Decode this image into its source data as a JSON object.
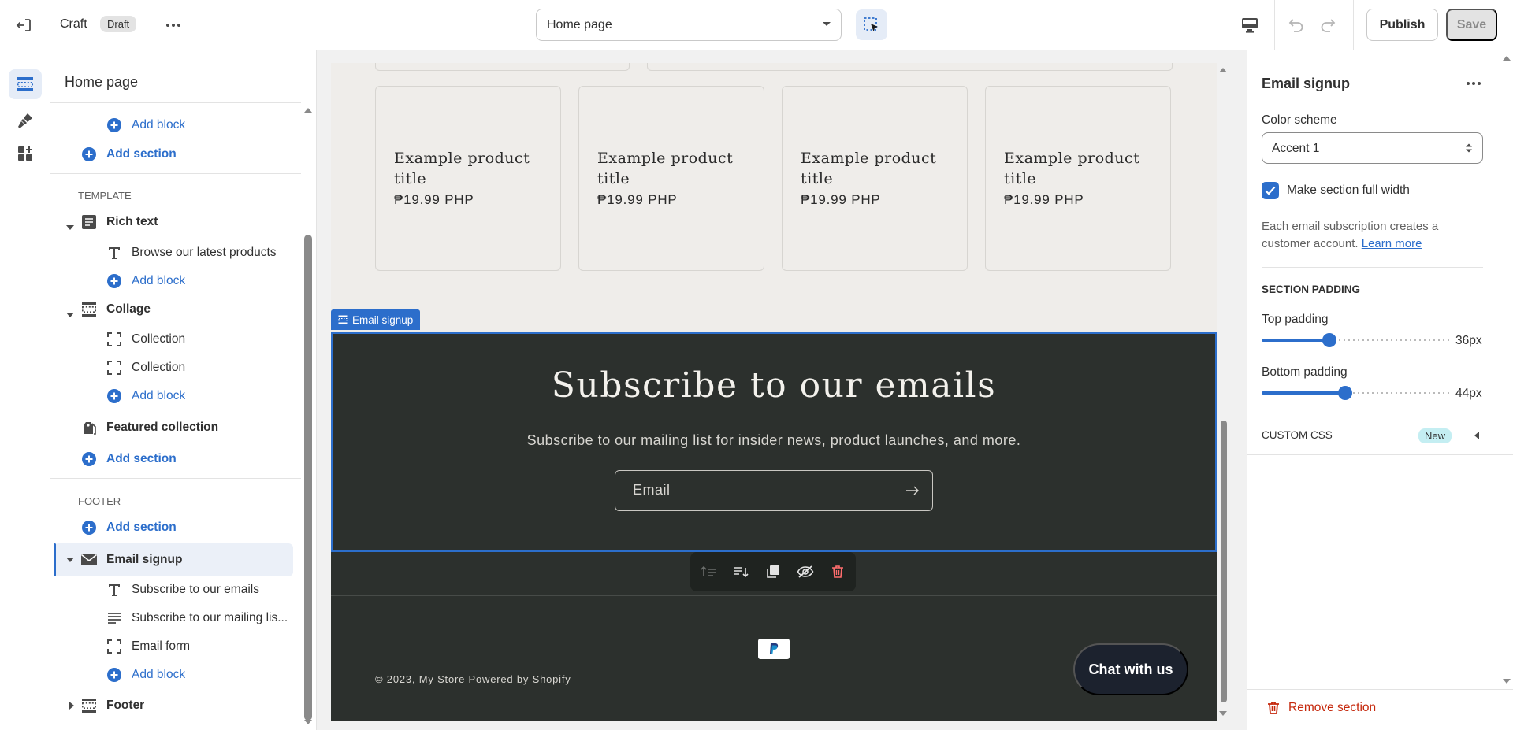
{
  "topbar": {
    "theme_name": "Craft",
    "status_badge": "Draft",
    "page_selector": "Home page",
    "publish_label": "Publish",
    "save_label": "Save"
  },
  "sidebar": {
    "title": "Home page",
    "header_add_block": "Add block",
    "header_add_section": "Add section",
    "template_label": "TEMPLATE",
    "rich_text": "Rich text",
    "rich_text_block": "Browse our latest products",
    "rich_text_add_block": "Add block",
    "collage": "Collage",
    "collage_block_1": "Collection",
    "collage_block_2": "Collection",
    "collage_add_block": "Add block",
    "featured_collection": "Featured collection",
    "template_add_section": "Add section",
    "footer_label": "FOOTER",
    "footer_add_section": "Add section",
    "email_signup": "Email signup",
    "email_block_1": "Subscribe to our emails",
    "email_block_2": "Subscribe to our mailing lis...",
    "email_block_3": "Email form",
    "email_add_block": "Add block",
    "footer": "Footer"
  },
  "preview": {
    "products": [
      {
        "title": "Example product title",
        "price": "₱19.99 PHP"
      },
      {
        "title": "Example product title",
        "price": "₱19.99 PHP"
      },
      {
        "title": "Example product title",
        "price": "₱19.99 PHP"
      },
      {
        "title": "Example product title",
        "price": "₱19.99 PHP"
      }
    ],
    "section_tag": "Email signup",
    "email_heading": "Subscribe to our emails",
    "email_subtext": "Subscribe to our mailing list for insider news, product launches, and more.",
    "email_placeholder": "Email",
    "payment_icon": "paypal-icon",
    "copyright": "© 2023, My Store Powered by Shopify",
    "chat_button": "Chat with us"
  },
  "settings": {
    "title": "Email signup",
    "color_scheme_label": "Color scheme",
    "color_scheme_value": "Accent 1",
    "full_width_label": "Make section full width",
    "full_width_checked": true,
    "help_text": "Each email subscription creates a customer account.",
    "learn_more": "Learn more",
    "section_padding_heading": "SECTION PADDING",
    "top_padding_label": "Top padding",
    "top_padding_value": "36px",
    "top_padding_fraction": 0.36,
    "bottom_padding_label": "Bottom padding",
    "bottom_padding_value": "44px",
    "bottom_padding_fraction": 0.44,
    "custom_css_label": "CUSTOM CSS",
    "custom_css_badge": "New",
    "remove_section": "Remove section"
  },
  "colors": {
    "accent": "#2c6ecb",
    "email_section_bg": "#2c302d",
    "preview_bg": "#efedea",
    "danger": "#c5280c"
  }
}
